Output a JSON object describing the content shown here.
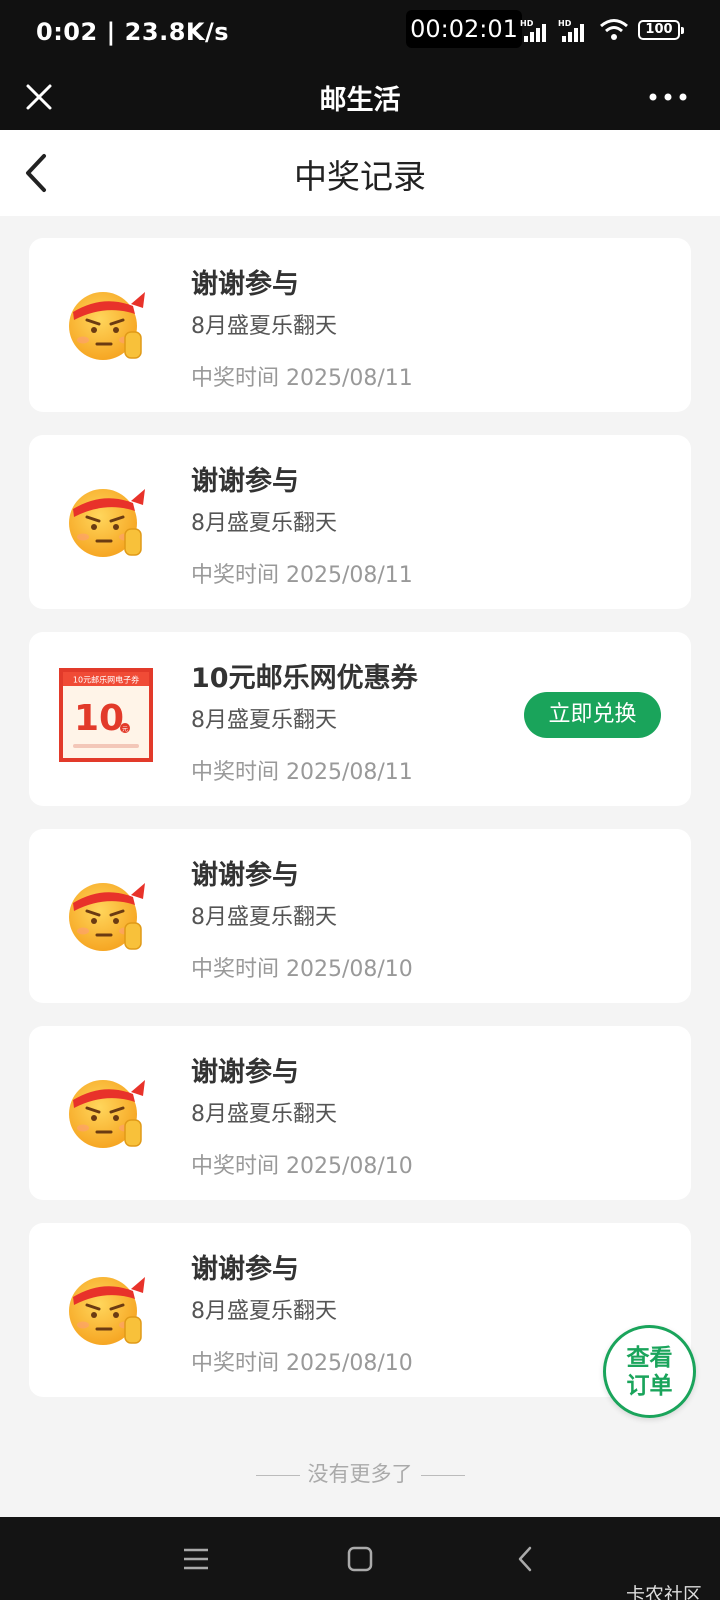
{
  "status_bar": {
    "left": "0:02 | 23.8K/s",
    "timer": "00:02:01",
    "battery": "100"
  },
  "title_bar": {
    "title": "邮生活"
  },
  "page_header": {
    "title": "中奖记录"
  },
  "records": [
    {
      "name": "谢谢参与",
      "event": "8月盛夏乐翻天",
      "time": "中奖时间 2025/08/11",
      "thumb": "emoji-thumb"
    },
    {
      "name": "谢谢参与",
      "event": "8月盛夏乐翻天",
      "time": "中奖时间 2025/08/11",
      "thumb": "emoji-thumb"
    },
    {
      "name": "10元邮乐网优惠券",
      "event": "8月盛夏乐翻天",
      "time": "中奖时间 2025/08/11",
      "thumb": "coupon",
      "action": "立即兑换",
      "coupon": {
        "header": "10元邮乐网电子券",
        "amount": "10",
        "unit": "元"
      }
    },
    {
      "name": "谢谢参与",
      "event": "8月盛夏乐翻天",
      "time": "中奖时间 2025/08/10",
      "thumb": "emoji-thumb"
    },
    {
      "name": "谢谢参与",
      "event": "8月盛夏乐翻天",
      "time": "中奖时间 2025/08/10",
      "thumb": "emoji-thumb"
    },
    {
      "name": "谢谢参与",
      "event": "8月盛夏乐翻天",
      "time": "中奖时间 2025/08/10",
      "thumb": "emoji-thumb"
    }
  ],
  "fab": {
    "line1": "查看",
    "line2": "订单"
  },
  "no_more": "没有更多了",
  "watermark": "卡农社区",
  "colors": {
    "accent": "#1aa45b",
    "coupon_red": "#e23a2a"
  }
}
